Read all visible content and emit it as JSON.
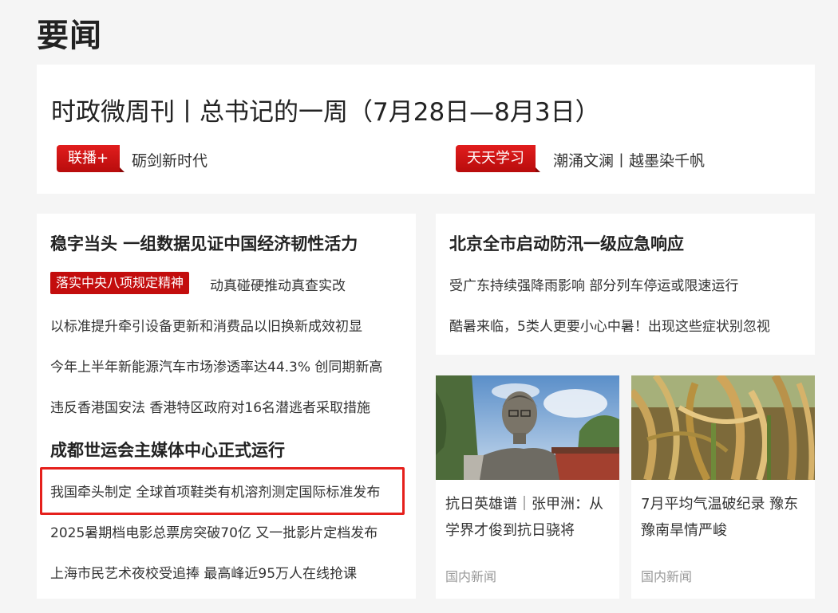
{
  "section": {
    "title": "要闻"
  },
  "top": {
    "headline": "时政微周刊丨总书记的一周（7月28日—8月3日）",
    "left": {
      "tag": "联播+",
      "text": "砺剑新时代"
    },
    "right": {
      "tag": "天天学习",
      "text": "潮涌文澜丨越墨染千帆"
    }
  },
  "left_column": {
    "title1": "稳字当头 一组数据见证中国经济韧性活力",
    "label": "落实中央八项规定精神",
    "label_text": "动真碰硬推动真查实改",
    "items1": [
      "以标准提升牵引设备更新和消费品以旧换新成效初显",
      "今年上半年新能源汽车市场渗透率达44.3% 创同期新高",
      "违反香港国安法 香港特区政府对16名潜逃者采取措施"
    ],
    "title2": "成都世运会主媒体中心正式运行",
    "items2": [
      "我国牵头制定 全球首项鞋类有机溶剂测定国际标准发布",
      "2025暑期档电影总票房突破70亿 又一批影片定档发布",
      "上海市民艺术夜校受追捧 最高峰近95万人在线抢课"
    ]
  },
  "right_column": {
    "title": "北京全市启动防汛一级应急响应",
    "items": [
      "受广东持续强降雨影响 部分列车停运或限速运行",
      "酷暑来临，5类人更要小心中暑！出现这些症状别忽视"
    ]
  },
  "cards": [
    {
      "caption": "抗日英雄谱｜张甲洲：从学界才俊到抗日骁将",
      "source": "国内新闻"
    },
    {
      "caption": "7月平均气温破纪录 豫东豫南旱情严峻",
      "source": "国内新闻"
    }
  ]
}
